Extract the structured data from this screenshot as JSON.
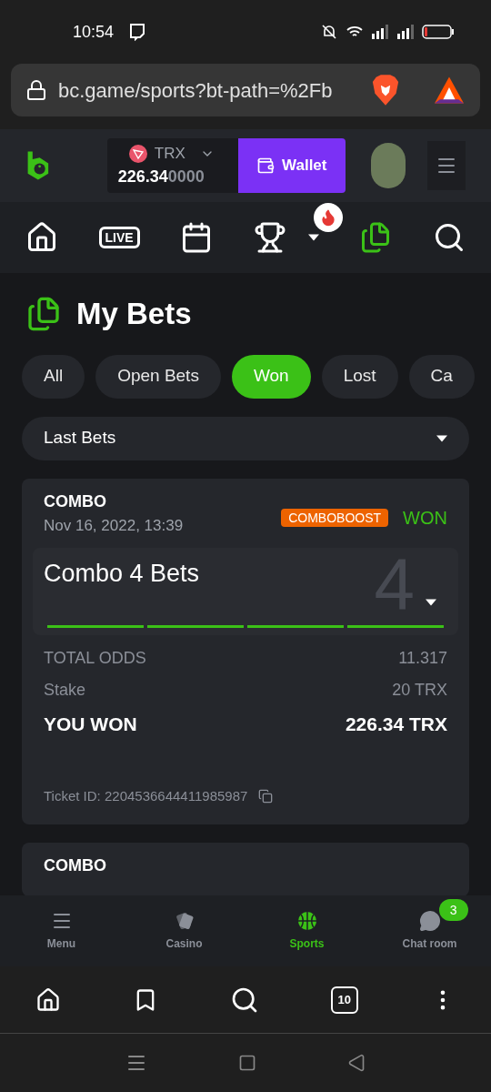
{
  "status_bar": {
    "time": "10:54"
  },
  "browser": {
    "url": "bc.game/sports?bt-path=%2Fb"
  },
  "header": {
    "currency": "TRX",
    "balance_main": "226.34",
    "balance_rest": "0000",
    "wallet_label": "Wallet"
  },
  "sports_nav": [
    {
      "kind": "home",
      "selected": false
    },
    {
      "kind": "live",
      "label": "LIVE",
      "selected": false
    },
    {
      "kind": "calendar",
      "selected": false
    },
    {
      "kind": "trophy",
      "selected": false
    },
    {
      "kind": "bets",
      "selected": true
    },
    {
      "kind": "search",
      "selected": false
    }
  ],
  "page_title": "My Bets",
  "filters": [
    {
      "label": "All",
      "selected": false
    },
    {
      "label": "Open Bets",
      "selected": false
    },
    {
      "label": "Won",
      "selected": true
    },
    {
      "label": "Lost",
      "selected": false
    },
    {
      "label": "Ca",
      "selected": false
    }
  ],
  "period_select": {
    "value": "Last Bets"
  },
  "bets": [
    {
      "type": "COMBO",
      "date": "Nov 16, 2022, 13:39",
      "badge": "COMBOBOOST",
      "result": "WON",
      "title": "Combo 4 Bets",
      "count": "4",
      "legs": [
        {
          "color": "#3bc117"
        },
        {
          "color": "#3bc117"
        },
        {
          "color": "#3bc117"
        },
        {
          "color": "#3bc117"
        }
      ],
      "total_odds_label": "TOTAL ODDS",
      "total_odds": "11.317",
      "stake_label": "Stake",
      "stake": "20 TRX",
      "won_label": "YOU WON",
      "won": "226.34 TRX",
      "ticket": "Ticket ID: 2204536644411985987"
    },
    {
      "type": "COMBO"
    }
  ],
  "bottom_nav": [
    {
      "kind": "menu",
      "label": "Menu",
      "selected": false
    },
    {
      "kind": "casino",
      "label": "Casino",
      "selected": false
    },
    {
      "kind": "sports",
      "label": "Sports",
      "selected": true
    },
    {
      "kind": "chat",
      "label": "Chat room",
      "selected": false,
      "badge": "3"
    }
  ],
  "browser_toolbar": {
    "tabs_count": "10"
  }
}
